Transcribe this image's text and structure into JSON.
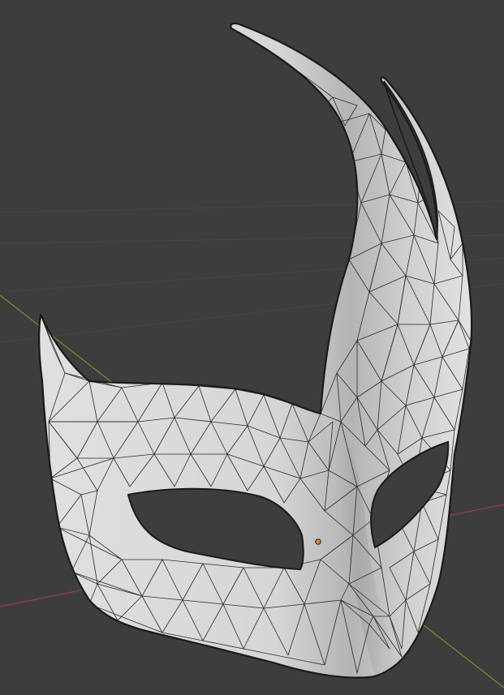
{
  "viewport": {
    "background_color": "#3d3d3d",
    "grid_line_color": "#474747",
    "x_axis_color": "#9a3c44",
    "y_axis_color": "#6a8f2c"
  },
  "object": {
    "name": "mask",
    "display_mode": "solid-wireframe",
    "surface_color": "#d9d9d9",
    "shadow_color": "#a9a9a9",
    "wire_color": "#2a2a2a",
    "origin_marker_color": "#e08a1e"
  }
}
